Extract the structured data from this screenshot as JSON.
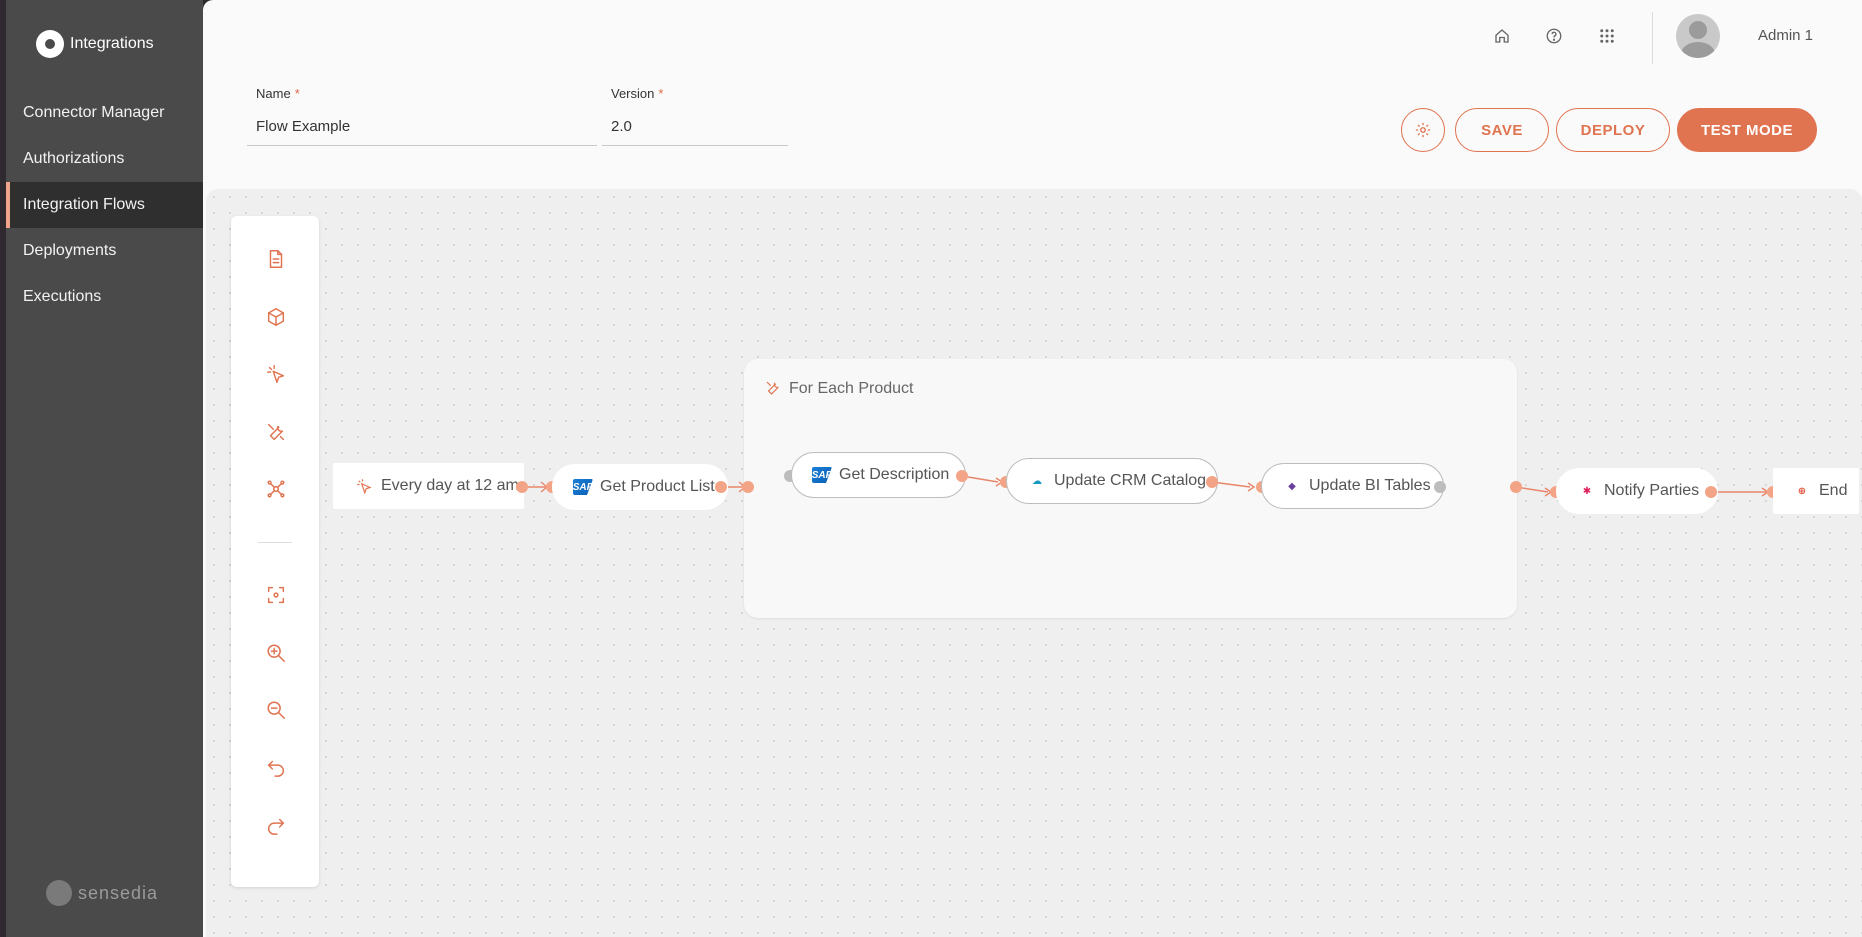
{
  "sidebar": {
    "logo_text": "Integrations",
    "items": [
      {
        "label": "Connector Manager",
        "active": false
      },
      {
        "label": "Authorizations",
        "active": false
      },
      {
        "label": "Integration Flows",
        "active": true
      },
      {
        "label": "Deployments",
        "active": false
      },
      {
        "label": "Executions",
        "active": false
      }
    ],
    "brand_text": "sensedia"
  },
  "topbar": {
    "icons": [
      "home-icon",
      "help-icon",
      "apps-grid-icon"
    ],
    "user_name": "Admin 1"
  },
  "form": {
    "name_label": "Name",
    "name_value": "Flow Example",
    "version_label": "Version",
    "version_value": "2.0",
    "required_mark": "*"
  },
  "actions": {
    "save_label": "SAVE",
    "deploy_label": "DEPLOY",
    "test_mode_label": "TEST MODE"
  },
  "toolbar": {
    "tools": [
      "document-icon",
      "cube-icon",
      "trigger-icon",
      "tools-icon",
      "network-icon",
      "fit-view-icon",
      "zoom-in-icon",
      "zoom-out-icon",
      "undo-icon",
      "redo-icon"
    ]
  },
  "flow": {
    "trigger": "Every day at 12 am",
    "get_product_list": "Get Product List",
    "group_title": "For Each Product",
    "get_description": "Get Description",
    "update_crm": "Update CRM Catalog",
    "update_bi": "Update BI Tables",
    "notify": "Notify Parties",
    "end": "End",
    "sap_logo_text": "SAP"
  },
  "colors": {
    "accent": "#e07350",
    "port": "#f4a486",
    "sidebar_bg": "#4a4a4a"
  }
}
